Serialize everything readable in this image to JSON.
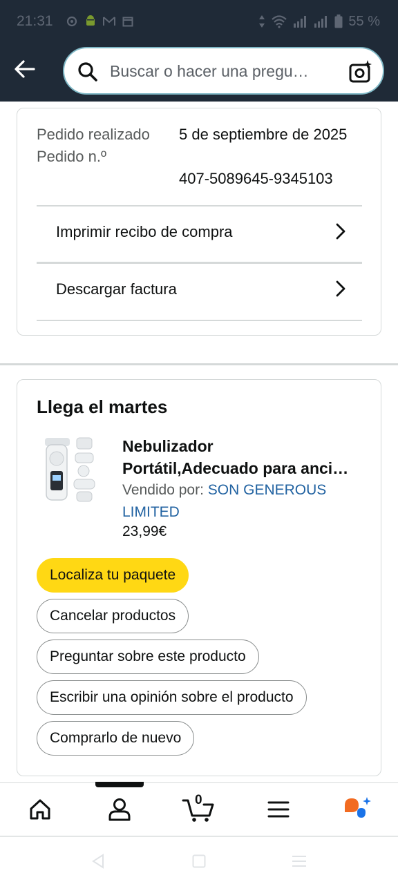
{
  "status_bar": {
    "time": "21:31",
    "battery": "55 %",
    "icons": [
      "settings-icon",
      "android-icon",
      "gmail-icon",
      "calendar-icon",
      "data-arrows-icon",
      "wifi-icon",
      "signal-icon",
      "signal-icon-2",
      "battery-icon"
    ]
  },
  "header": {
    "back_icon": "arrow-left-icon",
    "search_placeholder": "Buscar o hacer una pregu…",
    "camera_icon": "camera-ai-icon"
  },
  "order_info": {
    "placed_label": "Pedido realizado",
    "placed_value": "5 de septiembre de 2025",
    "number_label": "Pedido n.º",
    "number_value": "407-5089645-9345103",
    "links": [
      {
        "label": "Imprimir recibo de compra"
      },
      {
        "label": "Descargar factura"
      }
    ]
  },
  "shipment": {
    "title": "Llega el martes",
    "product": {
      "name_line1": "Nebulizador",
      "name_line2": "Portátil,Adecuado para anci…",
      "sold_by_label": "Vendido por: ",
      "seller_line1": "SON GENEROUS",
      "seller_line2": "LIMITED",
      "price": "23,99€"
    },
    "buttons": [
      {
        "label": "Localiza tu paquete"
      },
      {
        "label": "Cancelar productos"
      },
      {
        "label": "Preguntar sobre este producto"
      },
      {
        "label": "Escribir una opinión sobre el producto"
      },
      {
        "label": "Comprarlo de nuevo"
      }
    ]
  },
  "bottom_nav": {
    "items": [
      "home-icon",
      "account-icon",
      "cart-icon",
      "menu-icon",
      "rufus-icon"
    ],
    "cart_count": "0"
  },
  "colors": {
    "header_bg": "#1f2a37",
    "primary_button": "#ffd814",
    "link": "#2162a1",
    "search_border": "#7fb8c6"
  }
}
